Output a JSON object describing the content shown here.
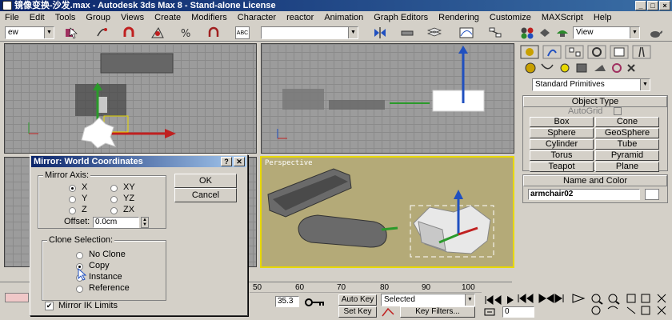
{
  "window": {
    "title": "镜像变换-沙发.max - Autodesk 3ds Max 8 - Stand-alone License"
  },
  "menu": [
    "File",
    "Edit",
    "Tools",
    "Group",
    "Views",
    "Create",
    "Modifiers",
    "Character",
    "reactor",
    "Animation",
    "Graph Editors",
    "Rendering",
    "Customize",
    "MAXScript",
    "Help"
  ],
  "toolbar": {
    "selection_filter": "ew",
    "named_sel": "",
    "ref_coord": "View",
    "abc_label": "ABC"
  },
  "viewports": {
    "perspective_label": "Perspective"
  },
  "command_panel": {
    "category": "Standard Primitives",
    "object_type_title": "Object Type",
    "autogrid_label": "AutoGrid",
    "buttons": [
      "Box",
      "Cone",
      "Sphere",
      "GeoSphere",
      "Cylinder",
      "Tube",
      "Torus",
      "Pyramid",
      "Teapot",
      "Plane"
    ],
    "name_color_title": "Name and Color",
    "object_name": "armchair02"
  },
  "dialog": {
    "title": "Mirror: World Coordinates",
    "help": "?",
    "close": "✕",
    "mirror_axis_label": "Mirror Axis:",
    "axes": [
      "X",
      "Y",
      "Z",
      "XY",
      "YZ",
      "ZX"
    ],
    "selected_axis": "X",
    "offset_label": "Offset:",
    "offset_value": "0.0cm",
    "clone_label": "Clone Selection:",
    "clone_options": [
      "No Clone",
      "Copy",
      "Instance",
      "Reference"
    ],
    "selected_clone": "Copy",
    "ok": "OK",
    "cancel": "Cancel",
    "mirror_ik_label": "Mirror IK Limits",
    "mirror_ik_checked": true
  },
  "timeline": {
    "ticks": [
      "50",
      "60",
      "70",
      "80",
      "90",
      "100"
    ],
    "coord_field": "35.3",
    "auto_key": "Auto Key",
    "set_key": "Set Key",
    "key_mode": "Selected",
    "key_filters": "Key Filters...",
    "frame": "0"
  }
}
